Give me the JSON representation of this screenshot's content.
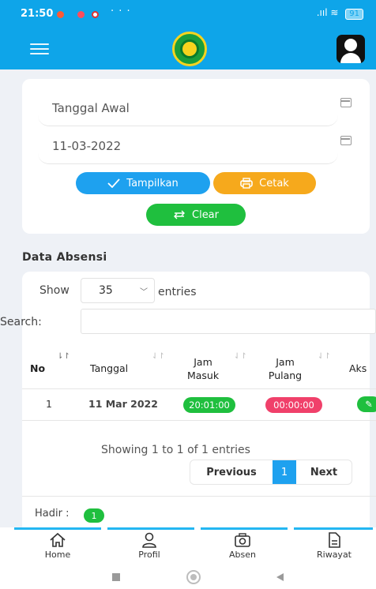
{
  "status_bar": {
    "time": "21:50",
    "more": "· · ·",
    "signal": ".ııl",
    "battery": "91"
  },
  "filter": {
    "start_date_placeholder": "Tanggal Awal",
    "end_date_value": "11-03-2022",
    "show_button": "Tampilkan",
    "print_button": "Cetak",
    "clear_button": "Clear"
  },
  "section_title": "Data Absensi",
  "table": {
    "show_label": "Show",
    "page_size": "35",
    "entries_label": "entries",
    "search_label": "Search:",
    "columns": {
      "no": "No",
      "tanggal": "Tanggal",
      "jam_masuk_1": "Jam",
      "jam_masuk_2": "Masuk",
      "jam_pulang_1": "Jam",
      "jam_pulang_2": "Pulang",
      "aksi": "Aks"
    },
    "rows": [
      {
        "no": "1",
        "tanggal": "11 Mar 2022",
        "jam_masuk": "20:01:00",
        "jam_pulang": "00:00:00"
      }
    ],
    "info": "Showing 1 to 1 of 1 entries",
    "pagination": {
      "previous": "Previous",
      "current": "1",
      "next": "Next"
    }
  },
  "summary": {
    "hadir_label": "Hadir :",
    "hadir_count": "1"
  },
  "bottom_nav": {
    "home": "Home",
    "profil": "Profil",
    "absen": "Absen",
    "riwayat": "Riwayat"
  },
  "colors": {
    "primary": "#0ea5e9",
    "green": "#1fbf3e",
    "orange": "#f6a91c",
    "red": "#f0406a"
  }
}
